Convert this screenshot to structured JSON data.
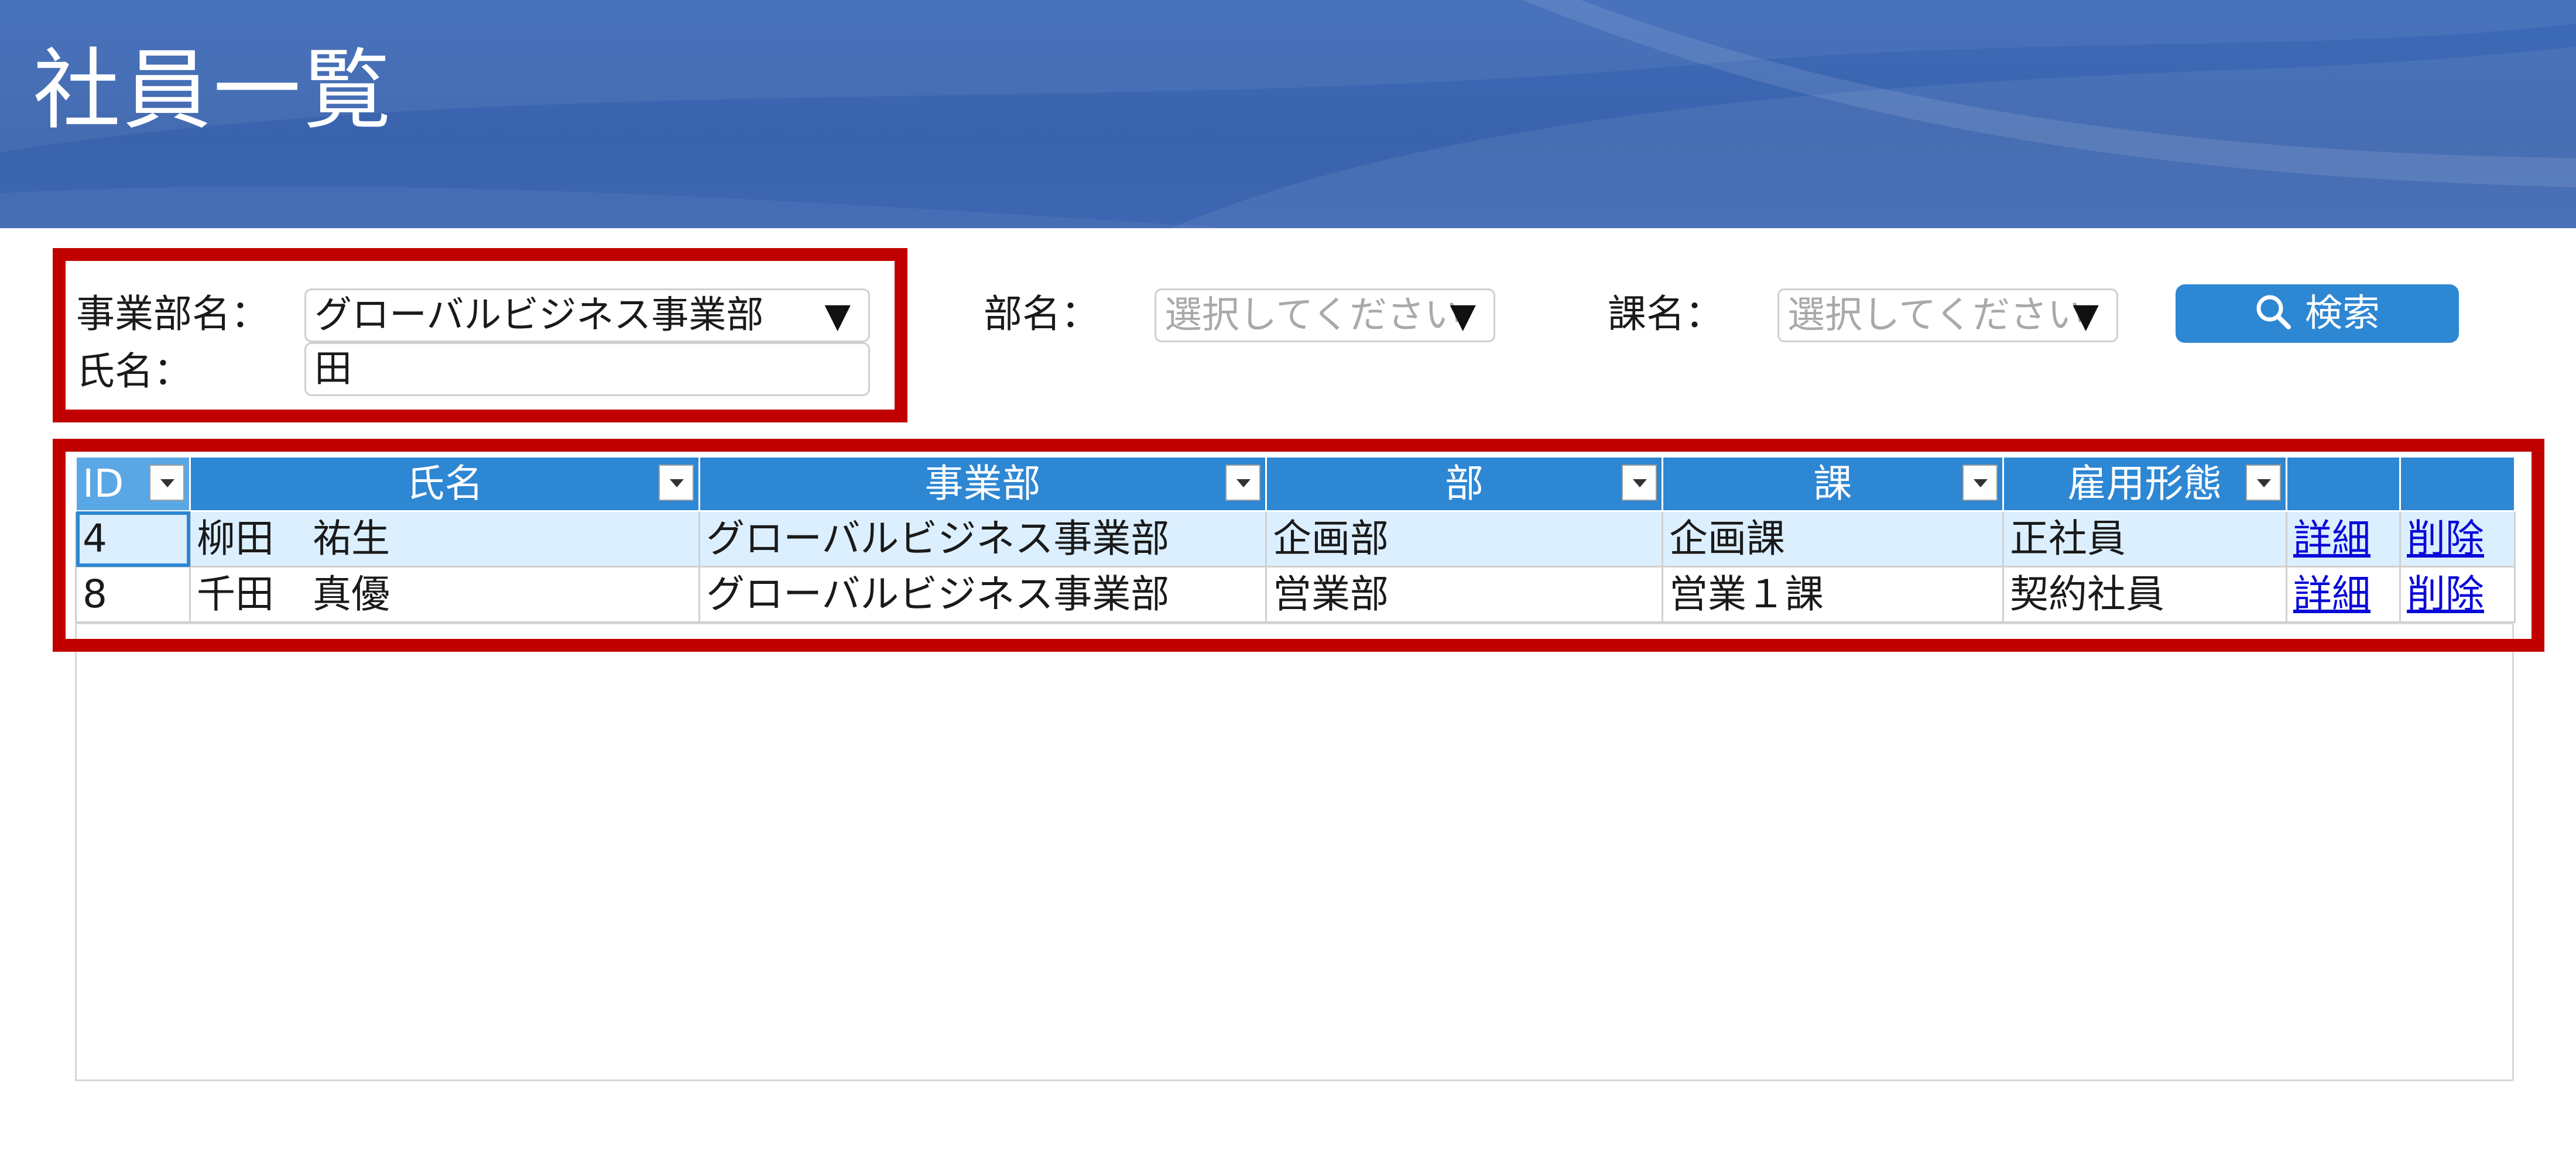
{
  "page_title": "社員一覧",
  "search": {
    "division_label": "事業部名：",
    "division_value": "グローバルビジネス事業部",
    "department_label": "部名：",
    "department_placeholder": "選択してください",
    "section_label": "課名：",
    "section_placeholder": "選択してください",
    "name_label": "氏名：",
    "name_value": "田",
    "search_button": "検索",
    "caret": "▼"
  },
  "grid": {
    "headers": [
      "ID",
      "氏名",
      "事業部",
      "部",
      "課",
      "雇用形態",
      "",
      ""
    ],
    "rows": [
      {
        "id": "4",
        "name": "柳田　祐生",
        "division": "グローバルビジネス事業部",
        "department": "企画部",
        "section": "企画課",
        "employment": "正社員",
        "detail": "詳細",
        "delete": "削除"
      },
      {
        "id": "8",
        "name": "千田　真優",
        "division": "グローバルビジネス事業部",
        "department": "営業部",
        "section": "営業１課",
        "employment": "契約社員",
        "detail": "詳細",
        "delete": "削除"
      }
    ]
  },
  "colors": {
    "header_bg": "#3a63ad",
    "grid_header": "#2d87d3",
    "highlight_box": "#c00000",
    "selected_row": "#dcefff",
    "link": "#0a0ad8"
  }
}
